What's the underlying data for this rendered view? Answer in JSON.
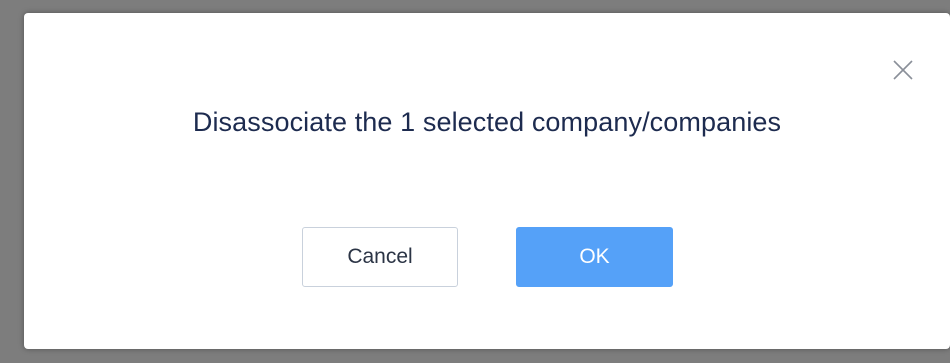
{
  "dialog": {
    "title": "Disassociate the 1 selected company/companies",
    "close_icon": "close-icon",
    "cancel_label": "Cancel",
    "ok_label": "OK"
  },
  "colors": {
    "backdrop": "#7d7d7d",
    "dialog_bg": "#ffffff",
    "title_text": "#1d2b4f",
    "primary": "#55a1f8",
    "secondary_border": "#c9d1dc"
  }
}
